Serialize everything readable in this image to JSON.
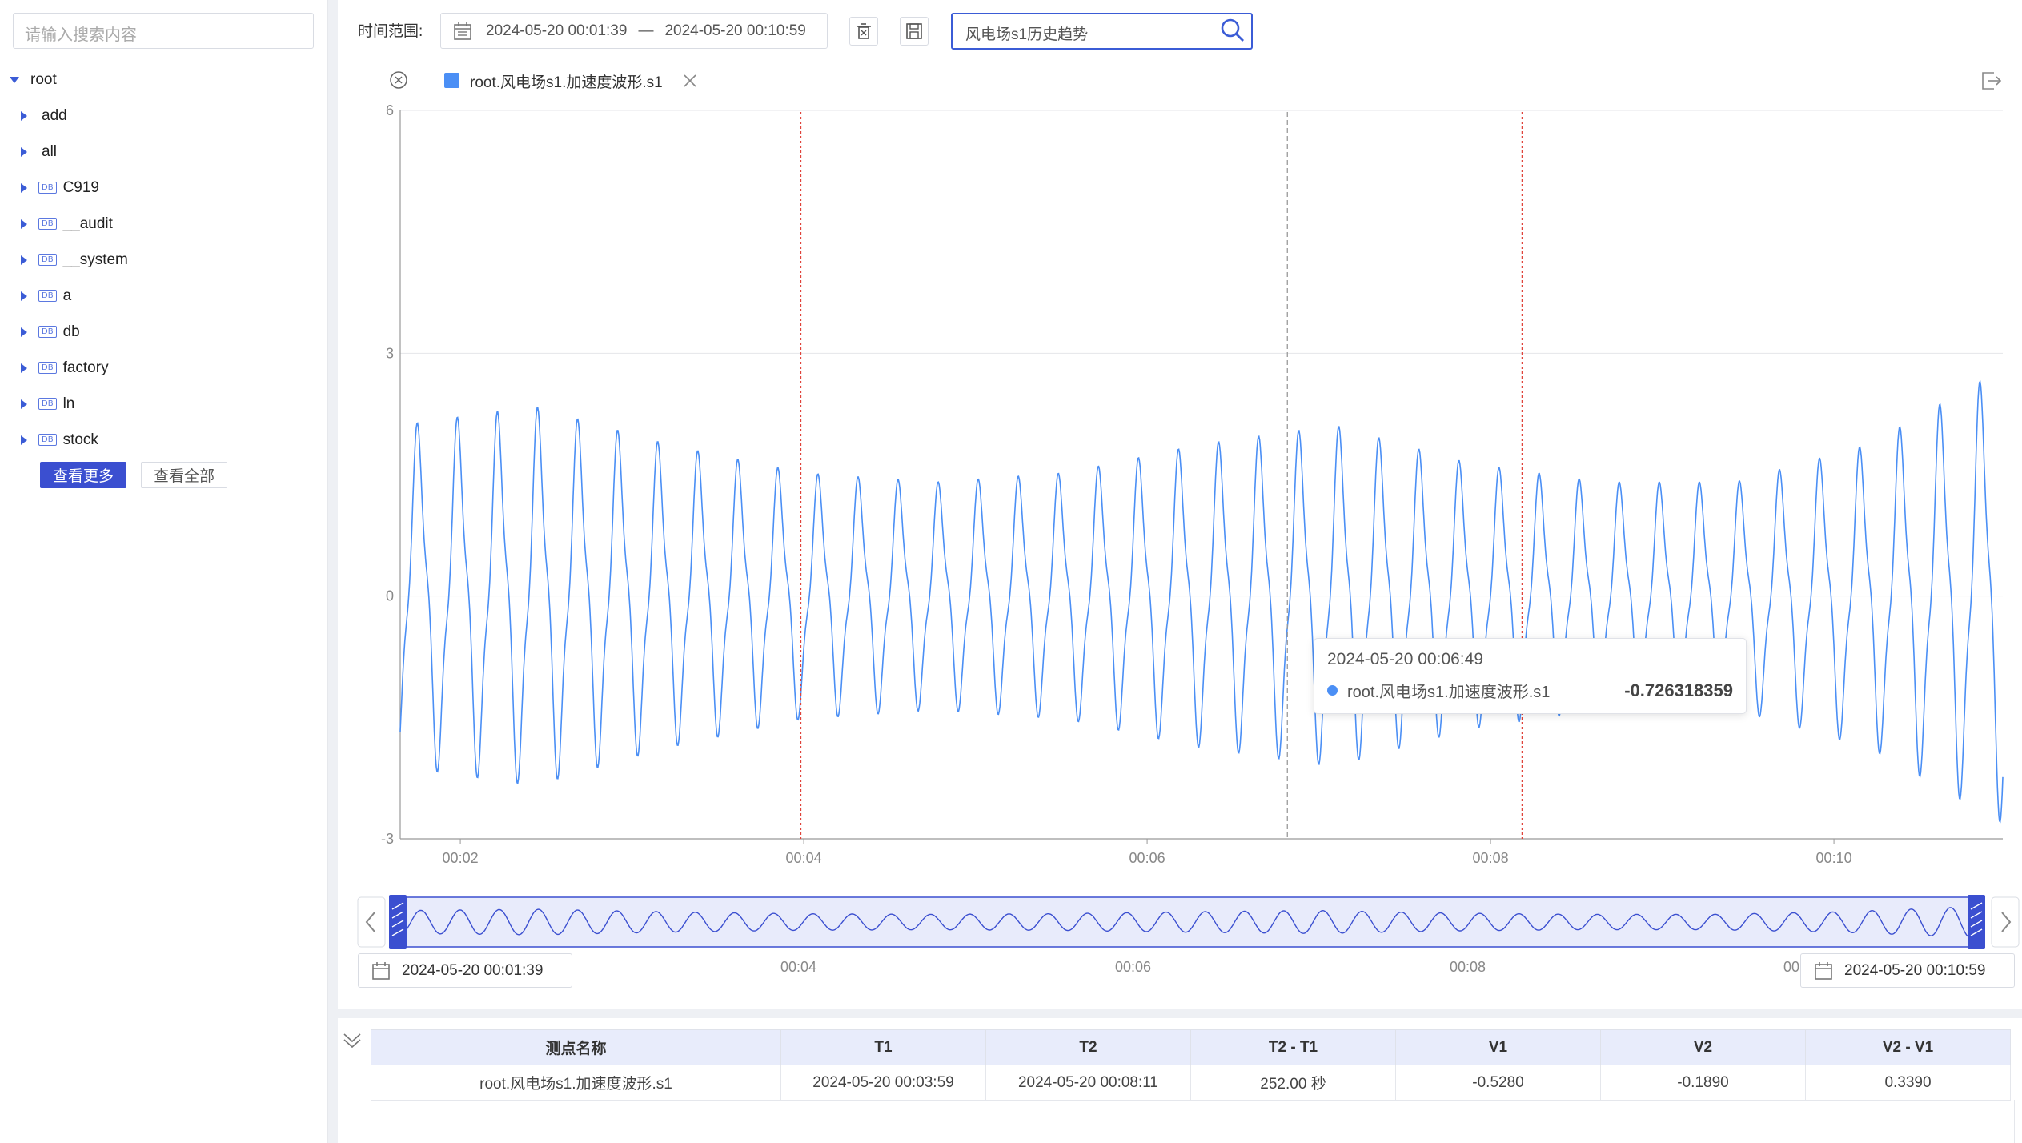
{
  "sidebar": {
    "search_placeholder": "请输入搜索内容",
    "root_label": "root",
    "items": [
      {
        "label": "add",
        "db": false
      },
      {
        "label": "all",
        "db": false
      },
      {
        "label": "C919",
        "db": true
      },
      {
        "label": "__audit",
        "db": true
      },
      {
        "label": "__system",
        "db": true
      },
      {
        "label": "a",
        "db": true
      },
      {
        "label": "db",
        "db": true
      },
      {
        "label": "factory",
        "db": true
      },
      {
        "label": "ln",
        "db": true
      },
      {
        "label": "stock",
        "db": true
      }
    ],
    "db_badge": "DB",
    "more_button": "查看更多",
    "all_button": "查看全部"
  },
  "toolbar": {
    "range_label": "时间范围:",
    "start_time": "2024-05-20 00:01:39",
    "separator": "—",
    "end_time": "2024-05-20 00:10:59",
    "query_value": "风电场s1历史趋势"
  },
  "legend": {
    "series_name": "root.风电场s1.加速度波形.s1",
    "color": "#4b8ff5"
  },
  "tooltip": {
    "time": "2024-05-20 00:06:49",
    "series": "root.风电场s1.加速度波形.s1",
    "value": "-0.726318359"
  },
  "chart_data": {
    "type": "line",
    "series": [
      {
        "name": "root.风电场s1.加速度波形.s1"
      }
    ],
    "x_range": [
      "2024-05-20 00:01:39",
      "2024-05-20 00:10:59"
    ],
    "x_ticks": [
      "00:02",
      "00:04",
      "00:06",
      "00:08",
      "00:10"
    ],
    "y_ticks": [
      "6",
      "3",
      "0",
      "-3"
    ],
    "ylim": [
      -3,
      6
    ],
    "grid": true,
    "markers": {
      "cursor1": "2024-05-20 00:03:59",
      "cursor2": "2024-05-20 00:08:11",
      "hover": "2024-05-20 00:06:49"
    },
    "oscillation": {
      "cycles": 40,
      "amplitude_profile": [
        1.8,
        2.0,
        1.6,
        1.3,
        1.2,
        1.3,
        1.6,
        1.8,
        1.4,
        1.2,
        1.2,
        1.6,
        2.4
      ]
    }
  },
  "slider": {
    "start": "2024-05-20 00:01:39",
    "end": "2024-05-20 00:10:59",
    "ticks": [
      "00:04",
      "00:06",
      "00:08",
      "00"
    ]
  },
  "table": {
    "headers": [
      "测点名称",
      "T1",
      "T2",
      "T2 - T1",
      "V1",
      "V2",
      "V2 - V1"
    ],
    "rows": [
      [
        "root.风电场s1.加速度波形.s1",
        "2024-05-20 00:03:59",
        "2024-05-20 00:08:11",
        "252.00 秒",
        "-0.5280",
        "-0.1890",
        "0.3390"
      ]
    ]
  }
}
